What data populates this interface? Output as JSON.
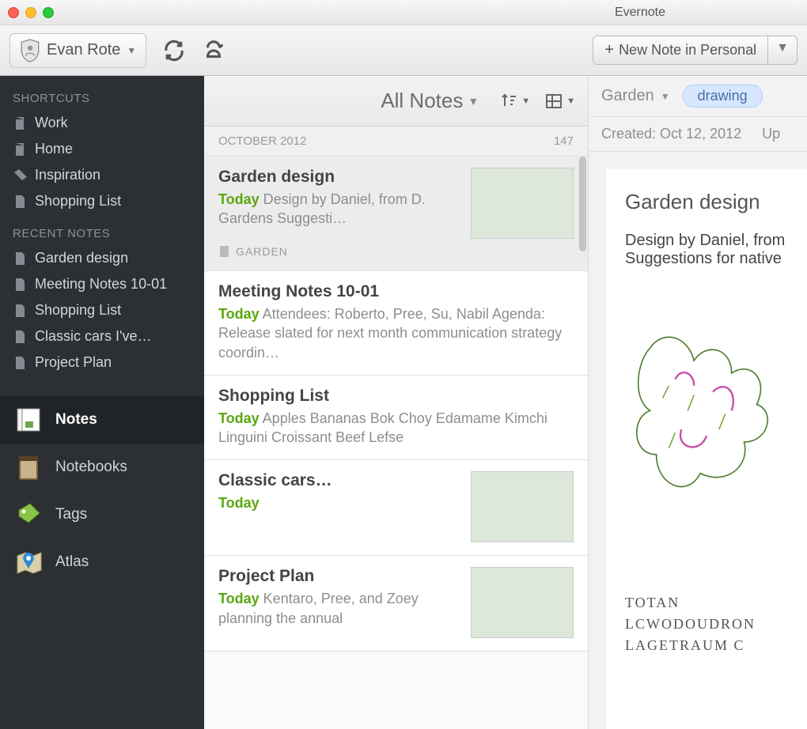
{
  "app": {
    "title": "Evernote"
  },
  "toolbar": {
    "account_name": "Evan Rote",
    "new_note_label": "New Note in Personal"
  },
  "sidebar": {
    "shortcuts_label": "SHORTCUTS",
    "shortcuts": [
      {
        "label": "Work"
      },
      {
        "label": "Home"
      },
      {
        "label": "Inspiration"
      },
      {
        "label": "Shopping List"
      }
    ],
    "recent_label": "RECENT NOTES",
    "recent": [
      {
        "label": "Garden design"
      },
      {
        "label": "Meeting Notes 10-01"
      },
      {
        "label": "Shopping List"
      },
      {
        "label": "Classic cars I've…"
      },
      {
        "label": "Project Plan"
      }
    ],
    "nav": [
      {
        "label": "Notes"
      },
      {
        "label": "Notebooks"
      },
      {
        "label": "Tags"
      },
      {
        "label": "Atlas"
      }
    ]
  },
  "notelist": {
    "header_title": "All Notes",
    "group_label": "OCTOBER 2012",
    "group_count": "147",
    "notes": [
      {
        "title": "Garden design",
        "date": "Today",
        "snippet": "Design by Daniel, from D. Gardens Suggesti…",
        "notebook": "GARDEN",
        "has_thumb": true,
        "thumb_class": "garden-thumb"
      },
      {
        "title": "Meeting Notes 10-01",
        "date": "Today",
        "snippet": "Attendees: Roberto, Pree, Su, Nabil Agenda: Release slated for next month communication strategy coordin…",
        "has_thumb": false
      },
      {
        "title": "Shopping List",
        "date": "Today",
        "snippet": "Apples Bananas Bok Choy Edamame Kimchi Linguini Croissant Beef Lefse",
        "has_thumb": false
      },
      {
        "title": "Classic cars…",
        "date": "Today",
        "snippet": "",
        "has_thumb": true,
        "thumb_class": "car-thumb"
      },
      {
        "title": "Project Plan",
        "date": "Today",
        "snippet": "Kentaro, Pree, and Zoey planning the annual",
        "has_thumb": true,
        "thumb_class": "plan-thumb"
      }
    ]
  },
  "detail": {
    "notebook": "Garden",
    "tag": "drawing",
    "created_label": "Created: Oct 12, 2012",
    "updated_label": "Up",
    "title": "Garden design",
    "body": "Design by Daniel, from\nSuggestions for native",
    "handwriting": "Totan\nLcwodoudron\nLagetraum c\n"
  }
}
